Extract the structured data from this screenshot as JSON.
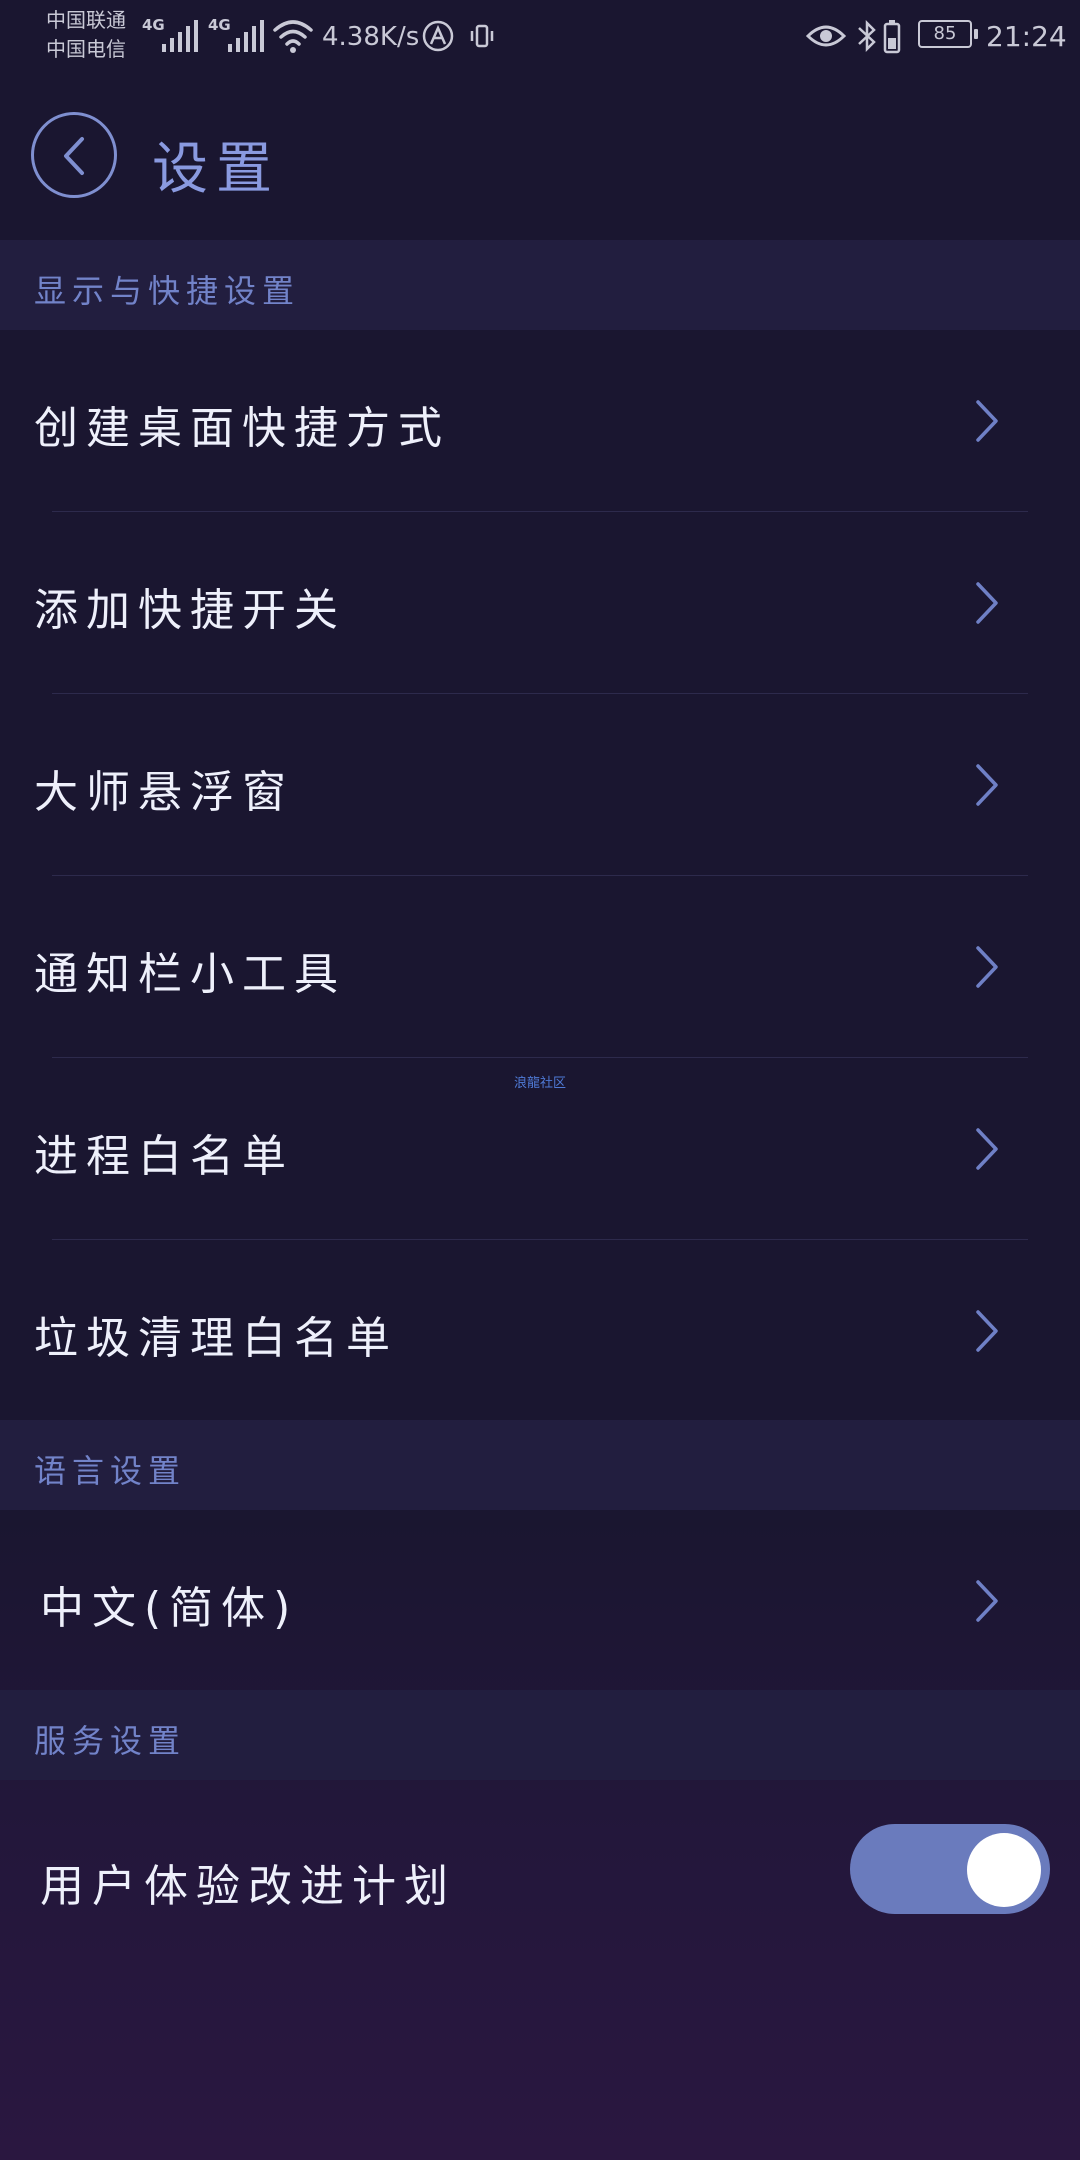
{
  "status_bar": {
    "carrier_1": "中国联通",
    "carrier_2": "中国电信",
    "network_type_1": "4G",
    "network_type_2": "4G",
    "net_speed": "4.38K/s",
    "battery_level": "85",
    "time": "21:24",
    "icons": [
      "signal-icon",
      "wifi-icon",
      "app-a-icon",
      "vibrate-icon",
      "eye-icon",
      "bluetooth-icon",
      "battery-saver-icon",
      "battery-icon"
    ]
  },
  "header": {
    "title": "设置",
    "back_icon": "chevron-left-icon"
  },
  "sections": [
    {
      "title": "显示与快捷设置",
      "items": [
        {
          "label": "创建桌面快捷方式"
        },
        {
          "label": "添加快捷开关"
        },
        {
          "label": "大师悬浮窗"
        },
        {
          "label": "通知栏小工具"
        },
        {
          "label": "进程白名单"
        },
        {
          "label": "垃圾清理白名单"
        }
      ]
    },
    {
      "title": "语言设置",
      "items": [
        {
          "label": "中文(简体)"
        }
      ]
    },
    {
      "title": "服务设置",
      "items": [
        {
          "label": "用户体验改进计划",
          "toggle_on": true
        }
      ]
    }
  ],
  "watermark": "浪龍社区",
  "colors": {
    "background": "#1a1630",
    "section_header_bg": "#221e3f",
    "accent": "#7f8fd0",
    "toggle_on": "#6a7bbd"
  }
}
